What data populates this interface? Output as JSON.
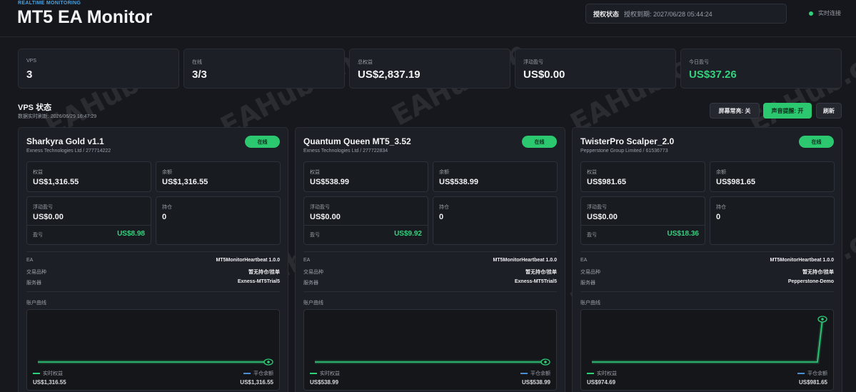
{
  "header": {
    "eyebrow": "REALTIME MONITORING",
    "title": "MT5 EA Monitor",
    "license_label": "授权状态",
    "license_value": "授权到期: 2027/06/28 05:44:24",
    "connection": "实时连接",
    "connection_color": "#2fd07a"
  },
  "stats": [
    {
      "label": "VPS",
      "value": "3"
    },
    {
      "label": "在线",
      "value": "3/3"
    },
    {
      "label": "总权益",
      "value": "US$2,837.19"
    },
    {
      "label": "浮动盈亏",
      "value": "US$0.00"
    },
    {
      "label": "今日盈亏",
      "value": "US$37.26"
    }
  ],
  "vps_section": {
    "title": "VPS 状态",
    "subtitle": "数据实时刷新:  2026/06/29 16:47:29",
    "buttons": {
      "screen": "屏幕常亮: 关",
      "sound": "声音提醒: 开",
      "refresh": "刷新"
    }
  },
  "labels": {
    "equity": "权益",
    "balance": "余额",
    "floating": "浮动盈亏",
    "positions": "持仓",
    "profit": "盈亏",
    "ea": "EA",
    "symbol": "交易品种",
    "server": "服务器",
    "curve": "账户曲线",
    "legend_equity": "实时权益",
    "legend_balance": "平仓余额",
    "status": "在线"
  },
  "cards": [
    {
      "name": "Sharkyra Gold v1.1",
      "broker": "Exness Technologies Ltd / 277714222",
      "equity": "US$1,316.55",
      "balance": "US$1,316.55",
      "floating": "US$0.00",
      "profit": "US$8.98",
      "positions": "0",
      "ea": "MT5MonitorHeartbeat 1.0.0",
      "symbol": "暂无持仓/挂单",
      "server": "Exness-MT5Trial5",
      "curve_equity": "US$1,316.55",
      "curve_balance": "US$1,316.55"
    },
    {
      "name": "Quantum Queen MT5_3.52",
      "broker": "Exness Technologies Ltd / 277722834",
      "equity": "US$538.99",
      "balance": "US$538.99",
      "floating": "US$0.00",
      "profit": "US$9.92",
      "positions": "0",
      "ea": "MT5MonitorHeartbeat 1.0.0",
      "symbol": "暂无持仓/挂单",
      "server": "Exness-MT5Trial5",
      "curve_equity": "US$538.99",
      "curve_balance": "US$538.99"
    },
    {
      "name": "TwisterPro Scalper_2.0",
      "broker": "Pepperstone Group Limited / 61536773",
      "equity": "US$981.65",
      "balance": "US$981.65",
      "floating": "US$0.00",
      "profit": "US$18.36",
      "positions": "0",
      "ea": "MT5MonitorHeartbeat 1.0.0",
      "symbol": "暂无持仓/挂单",
      "server": "Pepperstone-Demo",
      "curve_equity": "US$974.69",
      "curve_balance": "US$981.65"
    }
  ],
  "watermark": "EAHub.cn",
  "colors": {
    "accent_green": "#2bc870",
    "profit_green": "#34d27f",
    "eyebrow_blue": "#4aa3df",
    "balance_blue": "#4a8fd4"
  }
}
